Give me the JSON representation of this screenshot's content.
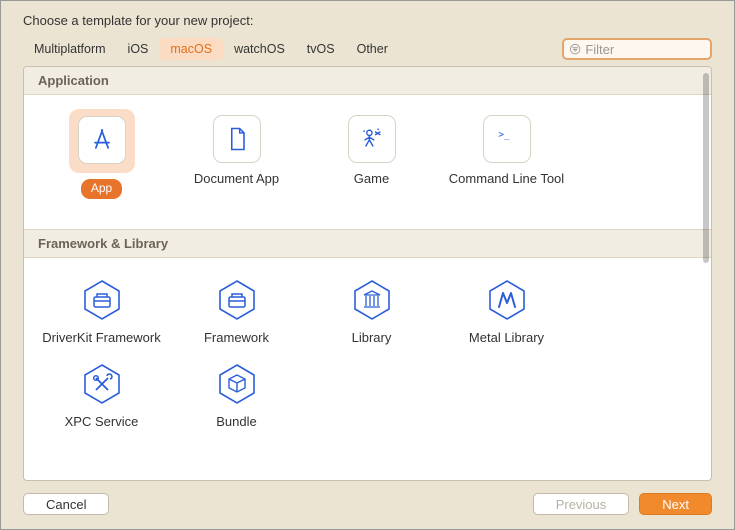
{
  "title": "Choose a template for your new project:",
  "tabs": [
    "Multiplatform",
    "iOS",
    "macOS",
    "watchOS",
    "tvOS",
    "Other"
  ],
  "selected_tab_index": 2,
  "filter": {
    "placeholder": "Filter",
    "value": ""
  },
  "sections": {
    "application": {
      "title": "Application",
      "items": [
        "App",
        "Document App",
        "Game",
        "Command Line Tool"
      ]
    },
    "framework": {
      "title": "Framework & Library",
      "items": [
        "DriverKit Framework",
        "Framework",
        "Library",
        "Metal Library",
        "XPC Service",
        "Bundle"
      ]
    }
  },
  "selected_item": "App",
  "footer": {
    "cancel": "Cancel",
    "previous": "Previous",
    "next": "Next"
  },
  "icons": {
    "app": "app-icon",
    "document_app": "document-icon",
    "game": "game-icon",
    "cli": "terminal-icon",
    "driverkit": "toolbox-hex-icon",
    "framework": "toolbox-hex-icon",
    "library": "library-hex-icon",
    "metal": "metal-hex-icon",
    "xpc": "tools-hex-icon",
    "bundle": "box-hex-icon"
  },
  "colors": {
    "accent": "#e8732a",
    "icon_blue": "#2b5fd9"
  }
}
